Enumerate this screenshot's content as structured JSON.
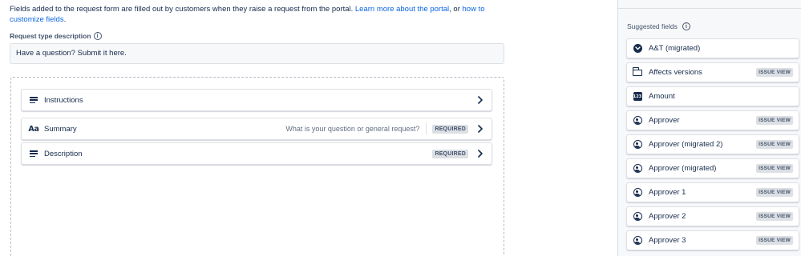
{
  "intro": {
    "text": "Fields added to the request form are filled out by customers when they raise a request from the portal. ",
    "link1": "Learn more about the portal",
    "sep": ", or ",
    "link2": "how to customize fields",
    "end": "."
  },
  "request_type": {
    "label": "Request type description",
    "value": "Have a question? Submit it here."
  },
  "form_fields": [
    {
      "icon": "lines-icon",
      "label": "Instructions",
      "hint": "",
      "badge": ""
    },
    {
      "icon": "text-aa-icon",
      "label": "Summary",
      "hint": "What is your question or general request?",
      "badge": "REQUIRED"
    },
    {
      "icon": "lines-icon",
      "label": "Description",
      "hint": "",
      "badge": "REQUIRED"
    }
  ],
  "sidebar": {
    "title": "Suggested fields",
    "items": [
      {
        "icon": "chevron-down-circle-icon",
        "label": "A&T (migrated)",
        "badge": ""
      },
      {
        "icon": "versions-icon",
        "label": "Affects versions",
        "badge": "ISSUE VIEW"
      },
      {
        "icon": "number-icon",
        "label": "Amount",
        "badge": ""
      },
      {
        "icon": "person-icon",
        "label": "Approver",
        "badge": "ISSUE VIEW"
      },
      {
        "icon": "person-icon",
        "label": "Approver (migrated 2)",
        "badge": "ISSUE VIEW"
      },
      {
        "icon": "person-icon",
        "label": "Approver (migrated)",
        "badge": "ISSUE VIEW"
      },
      {
        "icon": "person-icon",
        "label": "Approver 1",
        "badge": "ISSUE VIEW"
      },
      {
        "icon": "person-icon",
        "label": "Approver 2",
        "badge": "ISSUE VIEW"
      },
      {
        "icon": "person-icon",
        "label": "Approver 3",
        "badge": "ISSUE VIEW"
      }
    ]
  },
  "colors": {
    "link": "#0c66e4",
    "text": "#172b4d",
    "badge_bg": "#dcdfe4",
    "sidebar_bg": "#f7f8f9"
  }
}
